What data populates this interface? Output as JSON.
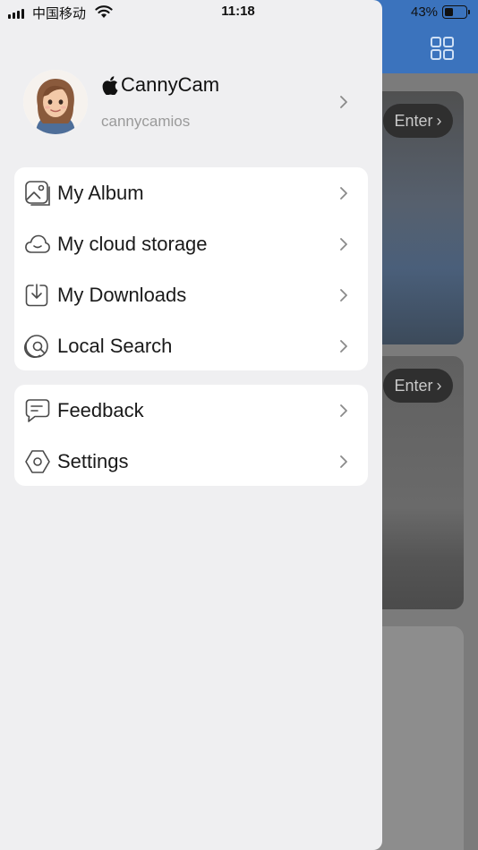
{
  "status_bar": {
    "carrier": "中国移动",
    "time": "11:18",
    "battery_percent": "43%",
    "battery_level": 0.43
  },
  "background": {
    "cards": [
      {
        "enter_label": "Enter"
      },
      {
        "enter_label": "Enter"
      }
    ],
    "header_color": "#3b73bd"
  },
  "profile": {
    "name": "CannyCam",
    "username": "cannycamios",
    "brand_icon": "apple-icon",
    "avatar": "girl-avatar"
  },
  "menu_group_1": [
    {
      "label": "My Album",
      "icon": "album-icon"
    },
    {
      "label": "My cloud storage",
      "icon": "cloud-icon"
    },
    {
      "label": "My Downloads",
      "icon": "download-icon"
    },
    {
      "label": "Local Search",
      "icon": "local-search-icon"
    }
  ],
  "menu_group_2": [
    {
      "label": "Feedback",
      "icon": "feedback-icon"
    },
    {
      "label": "Settings",
      "icon": "settings-icon"
    }
  ]
}
